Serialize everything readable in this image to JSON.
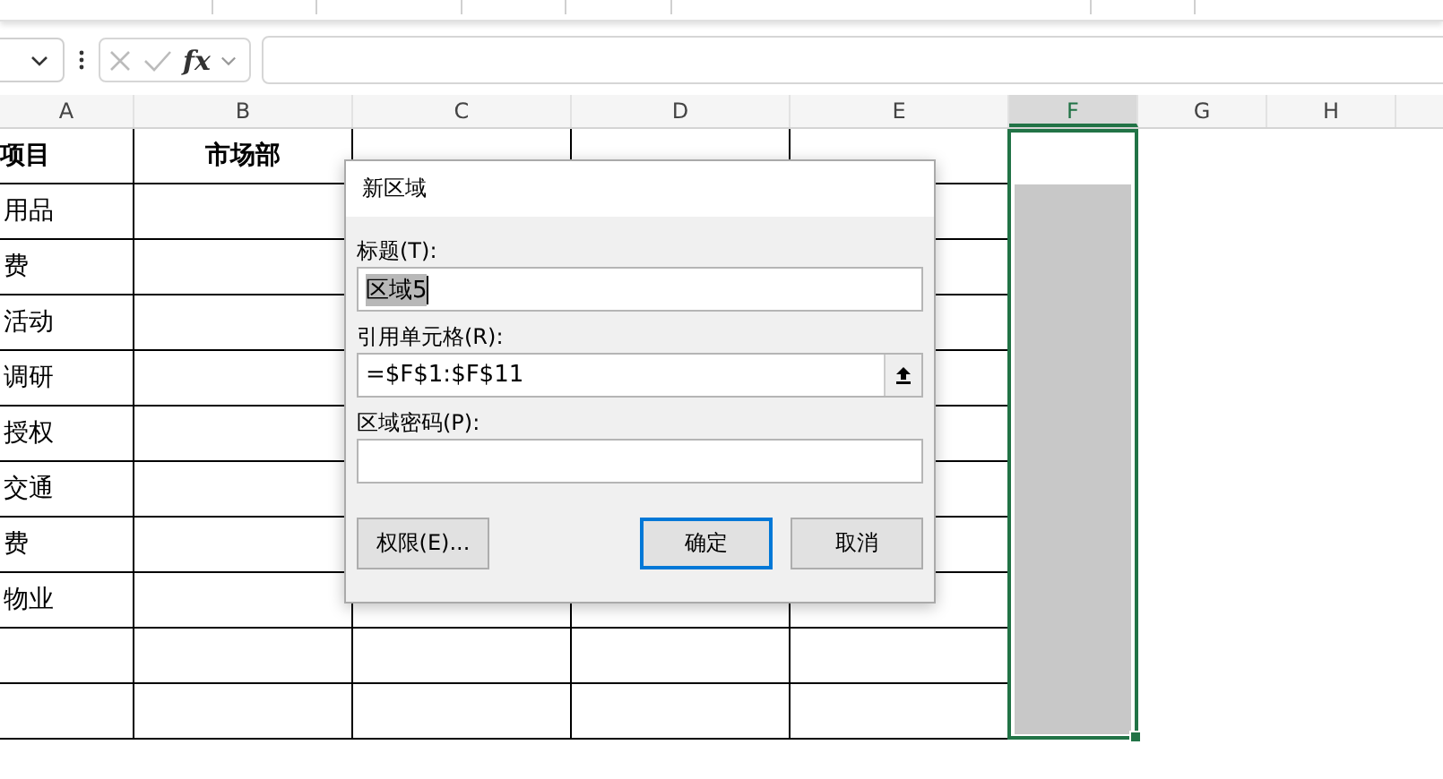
{
  "formula_bar": {
    "function_label": "fx"
  },
  "columns": [
    {
      "label": "A",
      "selected": false
    },
    {
      "label": "B",
      "selected": false
    },
    {
      "label": "C",
      "selected": false
    },
    {
      "label": "D",
      "selected": false
    },
    {
      "label": "E",
      "selected": false
    },
    {
      "label": "F",
      "selected": true
    },
    {
      "label": "G",
      "selected": false
    },
    {
      "label": "H",
      "selected": false
    }
  ],
  "table": {
    "header": [
      "项目",
      "市场部"
    ],
    "rows": [
      {
        "item": "用品"
      },
      {
        "item": "费"
      },
      {
        "item": "活动"
      },
      {
        "item": "调研"
      },
      {
        "item": "授权"
      },
      {
        "item": "交通"
      },
      {
        "item": "费"
      },
      {
        "item": "物业"
      },
      {},
      {}
    ]
  },
  "dialog": {
    "title": "新区域",
    "fields": [
      {
        "kind": "text",
        "label": "标题(T):",
        "value": "区域5",
        "selected": true
      },
      {
        "kind": "range",
        "label": "引用单元格(R):",
        "value": "=$F$1:$F$11"
      },
      {
        "kind": "text",
        "label": "区域密码(P):"
      }
    ],
    "buttons": [
      {
        "label": "权限(E)...",
        "default": false
      },
      {
        "label": "确定",
        "default": true
      },
      {
        "label": "取消",
        "default": false
      }
    ]
  }
}
